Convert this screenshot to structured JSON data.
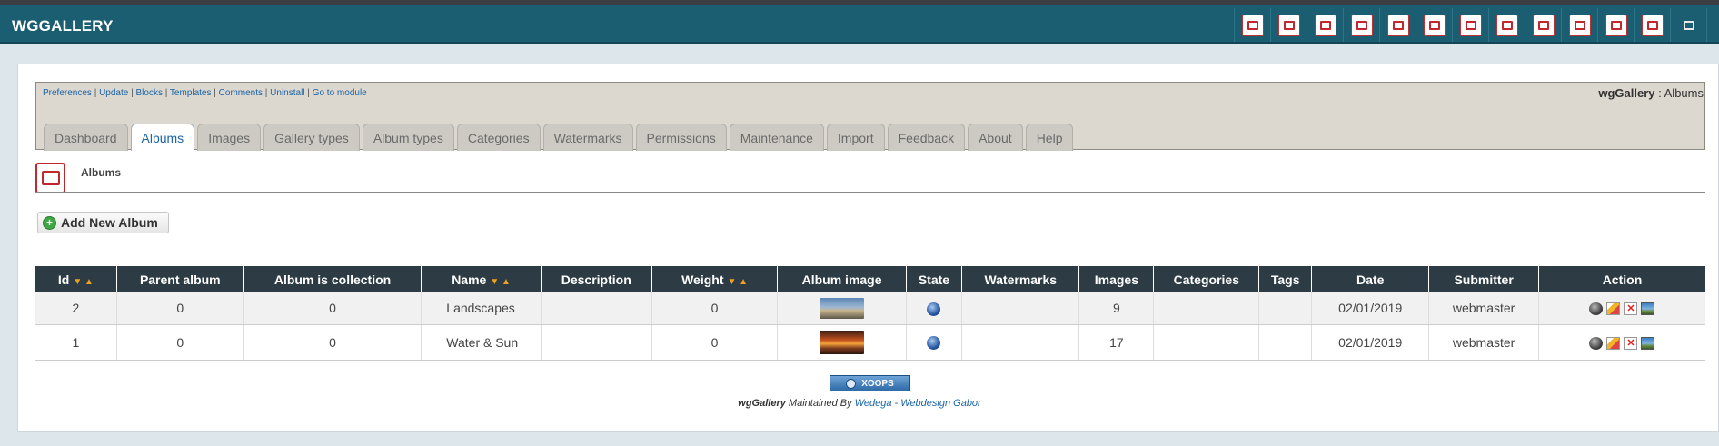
{
  "app": {
    "title": "WGGALLERY"
  },
  "toolbar_icons": [
    "dashboard-icon",
    "albums-icon",
    "images-icon",
    "gallery-types-icon",
    "album-types-icon",
    "categories-icon",
    "watermarks-icon",
    "permissions-icon",
    "maintenance-icon",
    "import-icon",
    "feedback-icon",
    "about-icon",
    "slideshow-icon",
    "settings-icon"
  ],
  "admin": {
    "links": [
      "Preferences",
      "Update",
      "Blocks",
      "Templates",
      "Comments",
      "Uninstall",
      "Go to module"
    ],
    "module_name": "wgGallery",
    "section": "Albums",
    "title_separator": " : "
  },
  "tabs": [
    {
      "label": "Dashboard",
      "active": false
    },
    {
      "label": "Albums",
      "active": true
    },
    {
      "label": "Images",
      "active": false
    },
    {
      "label": "Gallery types",
      "active": false
    },
    {
      "label": "Album types",
      "active": false
    },
    {
      "label": "Categories",
      "active": false
    },
    {
      "label": "Watermarks",
      "active": false
    },
    {
      "label": "Permissions",
      "active": false
    },
    {
      "label": "Maintenance",
      "active": false
    },
    {
      "label": "Import",
      "active": false
    },
    {
      "label": "Feedback",
      "active": false
    },
    {
      "label": "About",
      "active": false
    },
    {
      "label": "Help",
      "active": false
    }
  ],
  "page": {
    "section_title": "Albums",
    "add_button": "Add New Album"
  },
  "table": {
    "headers": [
      "Id",
      "Parent album",
      "Album is collection",
      "Name",
      "Description",
      "Weight",
      "Album image",
      "State",
      "Watermarks",
      "Images",
      "Categories",
      "Tags",
      "Date",
      "Submitter",
      "Action"
    ],
    "rows": [
      {
        "id": "2",
        "parent": "0",
        "collection": "0",
        "name": "Landscapes",
        "description": "",
        "weight": "0",
        "image": "landscape-thumbnail",
        "state": "online-icon",
        "watermarks": "",
        "images": "9",
        "categories": "",
        "tags": "",
        "date": "02/01/2019",
        "submitter": "webmaster"
      },
      {
        "id": "1",
        "parent": "0",
        "collection": "0",
        "name": "Water & Sun",
        "description": "",
        "weight": "0",
        "image": "sunset-thumbnail",
        "state": "online-icon",
        "watermarks": "",
        "images": "17",
        "categories": "",
        "tags": "",
        "date": "02/01/2019",
        "submitter": "webmaster"
      }
    ],
    "row_actions": [
      "view-icon",
      "edit-icon",
      "delete-icon",
      "images-icon"
    ]
  },
  "footer": {
    "badge": "XOOPS",
    "module": "wgGallery",
    "maintained_by": "Maintained By",
    "author_link": "Wedega - Webdesign Gabor"
  }
}
